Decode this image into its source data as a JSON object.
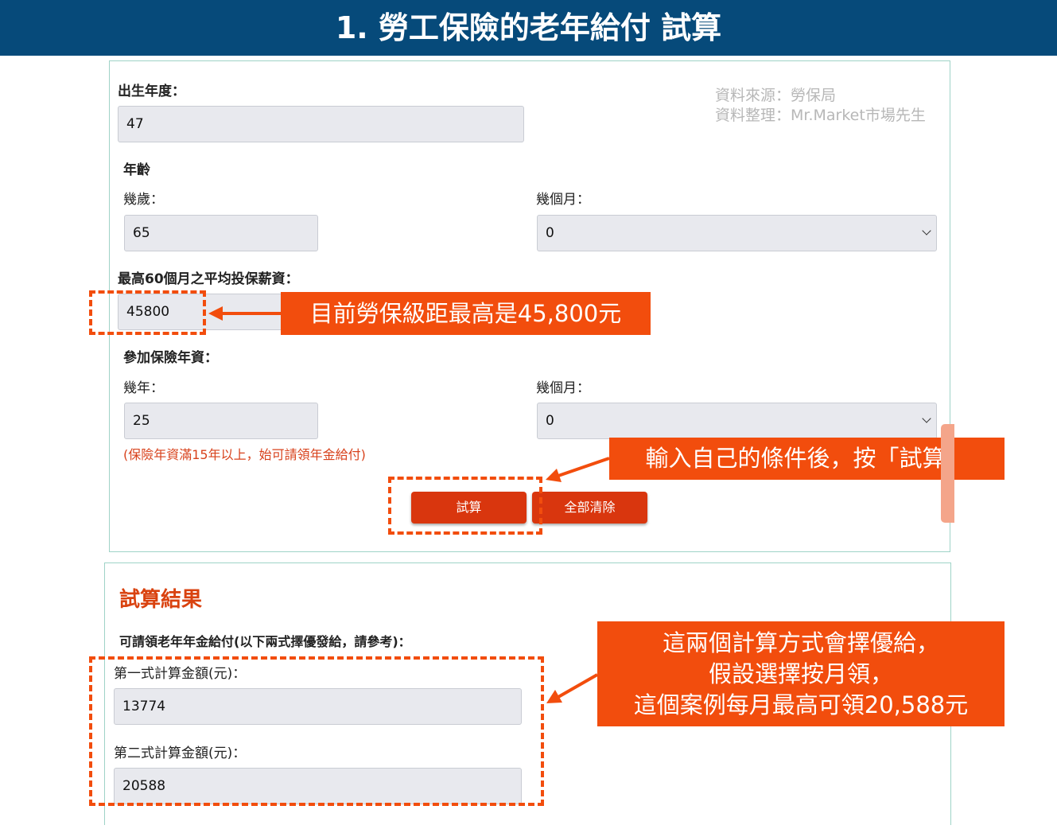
{
  "header": {
    "title": "1. 勞工保險的老年給付 試算"
  },
  "source": {
    "line1": "資料來源：勞保局",
    "line2": "資料整理：Mr.Market市場先生"
  },
  "form": {
    "birth_year_label": "出生年度：",
    "birth_year_value": "47",
    "age_label": "年齡",
    "age_years_label": "幾歲：",
    "age_years_value": "65",
    "age_months_label": "幾個月：",
    "age_months_value": "0",
    "avg_salary_label": "最高60個月之平均投保薪資：",
    "avg_salary_value": "45800",
    "seniority_label": "參加保險年資：",
    "seniority_years_label": "幾年：",
    "seniority_years_value": "25",
    "seniority_months_label": "幾個月：",
    "seniority_months_value": "0",
    "seniority_note": "(保險年資滿15年以上，始可請領年金給付)",
    "calc_button": "試算",
    "clear_button": "全部清除"
  },
  "result": {
    "title": "試算結果",
    "subtitle": "可請領老年年金給付(以下兩式擇優發給，請參考)：",
    "formula1_label": "第一式計算金額(元)：",
    "formula1_value": "13774",
    "formula2_label": "第二式計算金額(元)：",
    "formula2_value": "20588"
  },
  "callouts": {
    "salary": "目前勞保級距最高是45,800元",
    "calc": "輸入自己的條件後，按「試算」",
    "result_line1": "這兩個計算方式會擇優給，",
    "result_line2": "假設選擇按月領，",
    "result_line3": "這個案例每月最高可領20,588元"
  },
  "colors": {
    "header_bg": "#064a7a",
    "accent_orange": "#f24d0d",
    "button_red": "#d9360e",
    "panel_border": "#9fd3c7"
  }
}
